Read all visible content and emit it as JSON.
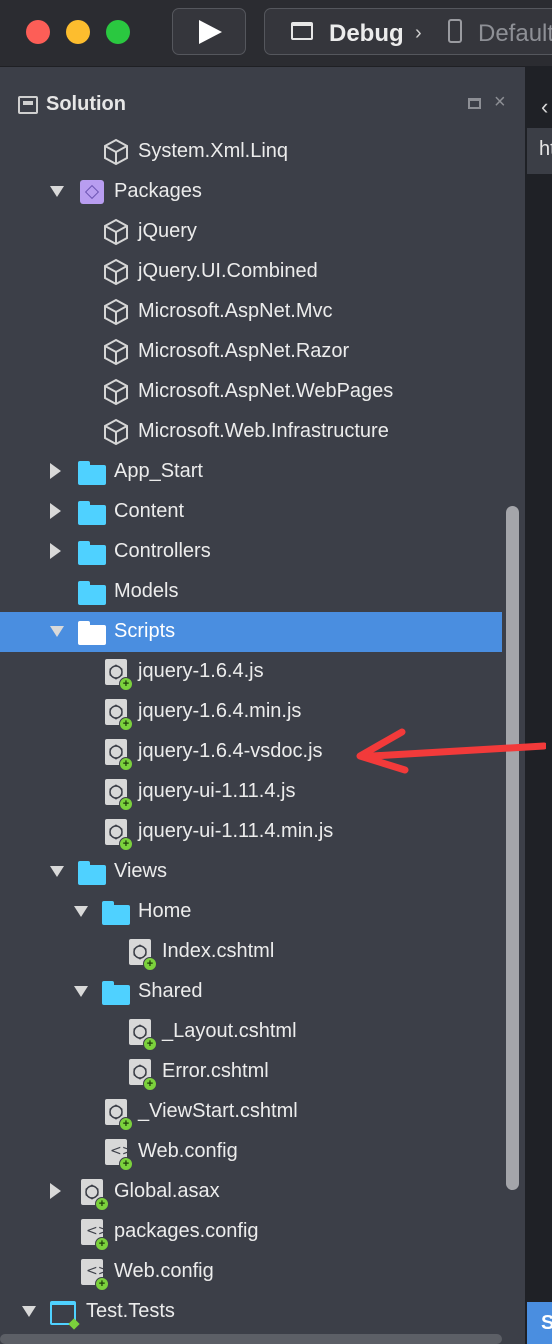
{
  "toolbar": {
    "configuration": "Debug",
    "separator": "›",
    "device": "Default"
  },
  "pad": {
    "title": "Solution",
    "close_glyph": "×"
  },
  "tree": [
    {
      "label": "System.Xml.Linq",
      "icon": "assembly-reference-icon",
      "expander": "none",
      "level": 2
    },
    {
      "label": "Packages",
      "icon": "packages-folder-icon",
      "expander": "expanded",
      "level": 1
    },
    {
      "label": "jQuery",
      "icon": "package-icon",
      "expander": "none",
      "level": 2
    },
    {
      "label": "jQuery.UI.Combined",
      "icon": "package-icon",
      "expander": "none",
      "level": 2
    },
    {
      "label": "Microsoft.AspNet.Mvc",
      "icon": "package-icon",
      "expander": "none",
      "level": 2
    },
    {
      "label": "Microsoft.AspNet.Razor",
      "icon": "package-icon",
      "expander": "none",
      "level": 2
    },
    {
      "label": "Microsoft.AspNet.WebPages",
      "icon": "package-icon",
      "expander": "none",
      "level": 2
    },
    {
      "label": "Microsoft.Web.Infrastructure",
      "icon": "package-icon",
      "expander": "none",
      "level": 2
    },
    {
      "label": "App_Start",
      "icon": "folder-icon",
      "expander": "collapsed",
      "level": 1
    },
    {
      "label": "Content",
      "icon": "folder-icon",
      "expander": "collapsed",
      "level": 1
    },
    {
      "label": "Controllers",
      "icon": "folder-icon",
      "expander": "collapsed",
      "level": 1
    },
    {
      "label": "Models",
      "icon": "folder-icon",
      "expander": "none",
      "level": 1
    },
    {
      "label": "Scripts",
      "icon": "folder-icon",
      "expander": "expanded",
      "level": 1,
      "selected": true
    },
    {
      "label": "jquery-1.6.4.js",
      "icon": "web-file-icon",
      "expander": "none",
      "level": 2
    },
    {
      "label": "jquery-1.6.4.min.js",
      "icon": "web-file-icon",
      "expander": "none",
      "level": 2
    },
    {
      "label": "jquery-1.6.4-vsdoc.js",
      "icon": "web-file-icon",
      "expander": "none",
      "level": 2
    },
    {
      "label": "jquery-ui-1.11.4.js",
      "icon": "web-file-icon",
      "expander": "none",
      "level": 2
    },
    {
      "label": "jquery-ui-1.11.4.min.js",
      "icon": "web-file-icon",
      "expander": "none",
      "level": 2
    },
    {
      "label": "Views",
      "icon": "folder-icon",
      "expander": "expanded",
      "level": 1
    },
    {
      "label": "Home",
      "icon": "folder-icon",
      "expander": "expanded",
      "level": 2
    },
    {
      "label": "Index.cshtml",
      "icon": "web-file-icon",
      "expander": "none",
      "level": 3
    },
    {
      "label": "Shared",
      "icon": "folder-icon",
      "expander": "expanded",
      "level": 2
    },
    {
      "label": "_Layout.cshtml",
      "icon": "web-file-icon",
      "expander": "none",
      "level": 3
    },
    {
      "label": "Error.cshtml",
      "icon": "web-file-icon",
      "expander": "none",
      "level": 3
    },
    {
      "label": "_ViewStart.cshtml",
      "icon": "web-file-icon",
      "expander": "none",
      "level": 2
    },
    {
      "label": "Web.config",
      "icon": "config-file-icon",
      "expander": "none",
      "level": 2
    },
    {
      "label": "Global.asax",
      "icon": "web-file-icon",
      "expander": "collapsed",
      "level": 1
    },
    {
      "label": "packages.config",
      "icon": "config-file-icon",
      "expander": "none",
      "level": 1
    },
    {
      "label": "Web.config",
      "icon": "config-file-icon",
      "expander": "none",
      "level": 1
    },
    {
      "label": "Test.Tests",
      "icon": "project-icon",
      "expander": "expanded",
      "level": 0
    }
  ],
  "right_strip": {
    "back_glyph": "‹",
    "tab_text": "ht",
    "bottom_text": "S"
  },
  "colors": {
    "selection": "#4a8ee0",
    "folder": "#4fd1ff",
    "added_badge": "#7bd13c",
    "annotation_arrow": "#f23a3a"
  }
}
